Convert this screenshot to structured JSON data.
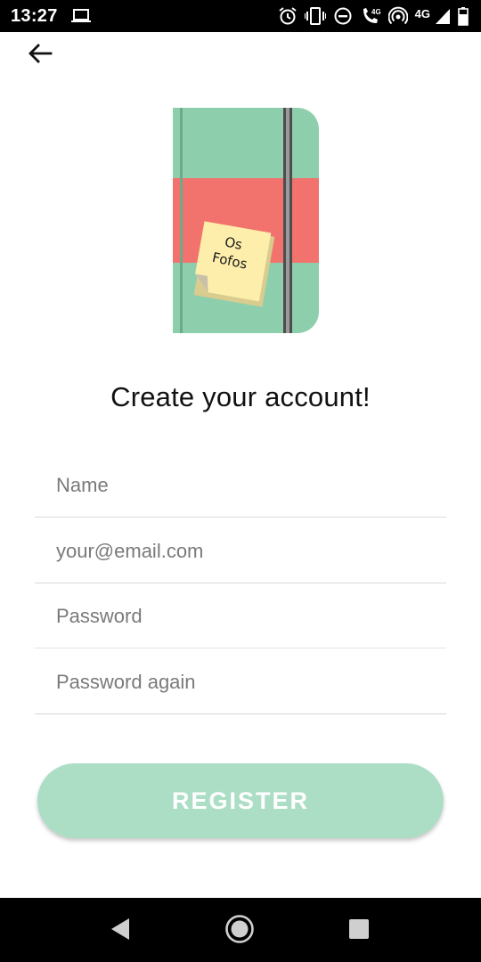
{
  "status_bar": {
    "time": "13:27",
    "network_label": "4G",
    "icons": [
      "laptop-icon",
      "alarm-icon",
      "vibrate-icon",
      "do-not-disturb-icon",
      "volte-call-icon",
      "hotspot-icon",
      "signal-icon",
      "battery-icon"
    ]
  },
  "header": {
    "back_icon": "arrow-left-icon"
  },
  "illustration": {
    "sticky_note_line1": "Os",
    "sticky_note_line2": "Fofos",
    "colors": {
      "cover": "#8dcfad",
      "band": "#f2726d",
      "note": "#fdeeab",
      "strap": "#5a5a5a"
    }
  },
  "title": "Create your account!",
  "form": {
    "name_placeholder": "Name",
    "email_placeholder": "your@email.com",
    "password_placeholder": "Password",
    "password_again_placeholder": "Password again"
  },
  "register_button": {
    "label": "REGISTER",
    "color": "#acdec6"
  },
  "nav_bar": {
    "icons": [
      "back-triangle-icon",
      "home-circle-icon",
      "recents-square-icon"
    ]
  }
}
